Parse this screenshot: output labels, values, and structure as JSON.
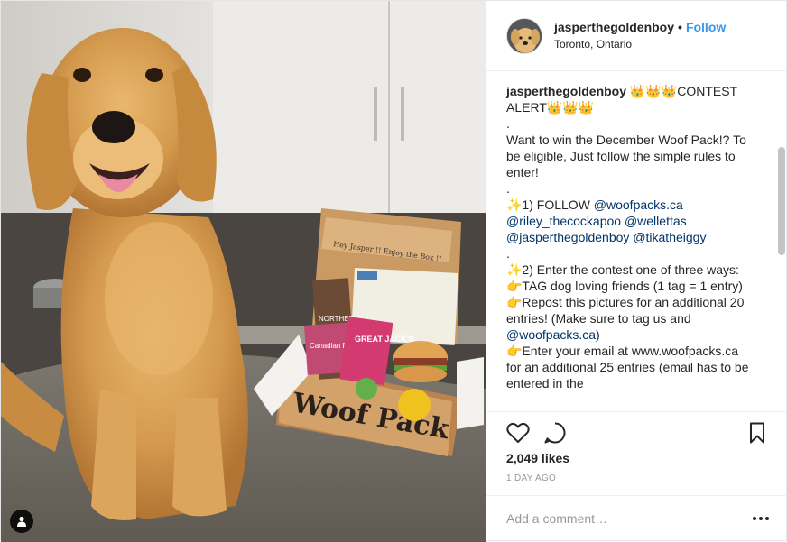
{
  "photo": {
    "box_brand_text": "Woof Pack",
    "note_text": "Hey Jasper !! Enjoy the Box !!",
    "product_labels": [
      "NORTHERN",
      "Canadian Bacon",
      "GREAT JACK'S"
    ]
  },
  "header": {
    "username": "jasperthegoldenboy",
    "separator": "•",
    "follow_label": "Follow",
    "location": "Toronto, Ontario"
  },
  "caption": {
    "username": "jasperthegoldenboy",
    "lines": [
      "👑👑👑CONTEST ALERT👑👑👑",
      ".",
      "Want to win the December Woof Pack!? To be eligible, Just follow the simple rules to enter!",
      ".",
      "✨1) FOLLOW ",
      ".",
      "✨2) Enter the contest one of three ways:",
      "👉TAG dog loving friends (1 tag = 1 entry)",
      "👉Repost this pictures for an additional 20 entries! (Make sure to tag us and ",
      "👉Enter your email at www.woofpacks.ca for an additional 25 entries (email has to be entered in the"
    ],
    "mentions_follow": [
      "@woofpacks.ca",
      "@riley_thecockapoo",
      "@wellettas",
      "@jasperthegoldenboy",
      "@tikatheiggy"
    ],
    "mention_repost": "@woofpacks.ca",
    "repost_tail": ")"
  },
  "actions": {
    "icons": [
      "heart-icon",
      "comment-icon",
      "bookmark-icon"
    ]
  },
  "likes": "2,049 likes",
  "time": "1 DAY AGO",
  "add_comment": {
    "placeholder": "Add a comment…",
    "more_icon": "more-options-icon"
  },
  "colors": {
    "accent": "#3897f0",
    "mention": "#003569",
    "muted": "#999999",
    "text": "#262626",
    "border": "#efefef"
  }
}
